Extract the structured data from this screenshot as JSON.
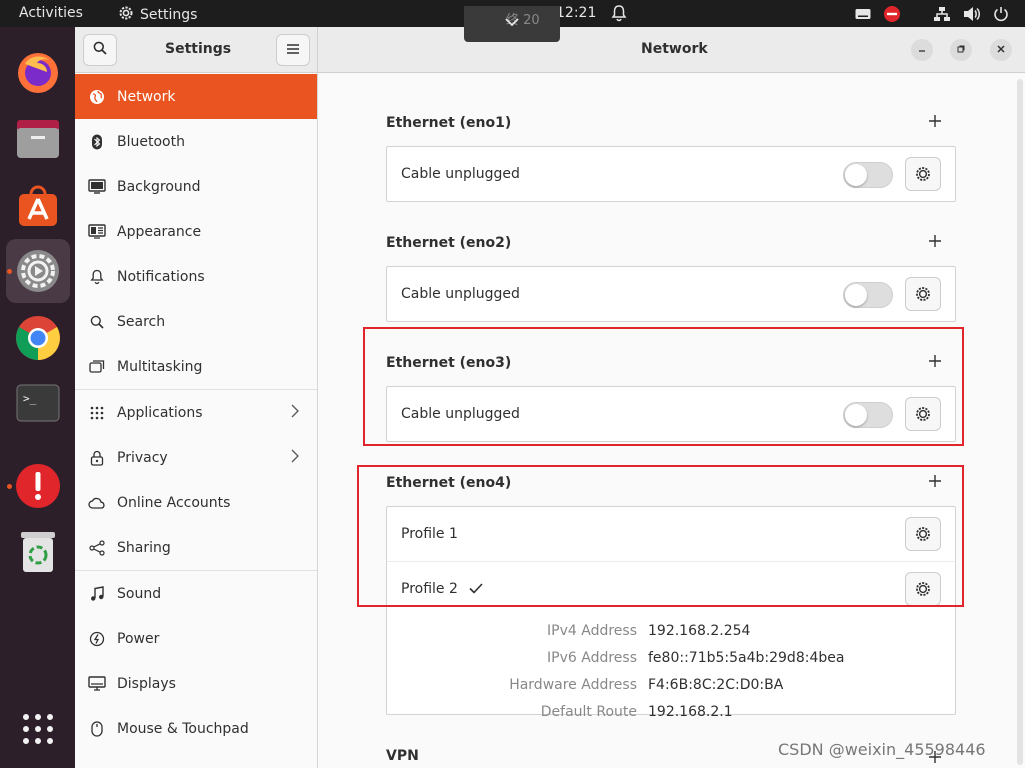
{
  "topbar": {
    "activities": "Activities",
    "app_name": "Settings",
    "clock": "12:21",
    "notif_dim_text": "终 20"
  },
  "dock": {
    "items": [
      "firefox-icon",
      "files-icon",
      "software-icon",
      "settings-icon",
      "chrome-icon",
      "terminal-icon",
      "updater-icon",
      "trash-icon",
      "apps-grid-icon"
    ]
  },
  "header": {
    "sidebar_title": "Settings",
    "page_title": "Network"
  },
  "sidebar": {
    "items": [
      {
        "label": "Network",
        "icon": "network-icon",
        "selected": true
      },
      {
        "label": "Bluetooth",
        "icon": "bluetooth-icon"
      },
      {
        "label": "Background",
        "icon": "background-icon"
      },
      {
        "label": "Appearance",
        "icon": "appearance-icon"
      },
      {
        "label": "Notifications",
        "icon": "bell-icon"
      },
      {
        "label": "Search",
        "icon": "search-icon"
      },
      {
        "label": "Multitasking",
        "icon": "multitasking-icon"
      },
      {
        "label": "Applications",
        "icon": "grid-icon",
        "chevron": true
      },
      {
        "label": "Privacy",
        "icon": "lock-icon",
        "chevron": true
      },
      {
        "label": "Online Accounts",
        "icon": "cloud-icon"
      },
      {
        "label": "Sharing",
        "icon": "share-icon"
      },
      {
        "label": "Sound",
        "icon": "music-icon"
      },
      {
        "label": "Power",
        "icon": "power-icon"
      },
      {
        "label": "Displays",
        "icon": "display-icon"
      },
      {
        "label": "Mouse & Touchpad",
        "icon": "mouse-icon"
      }
    ]
  },
  "network": {
    "sections": [
      {
        "title": "Ethernet (eno1)",
        "status": "Cable unplugged",
        "enabled": false
      },
      {
        "title": "Ethernet (eno2)",
        "status": "Cable unplugged",
        "enabled": false
      },
      {
        "title": "Ethernet (eno3)",
        "status": "Cable unplugged",
        "enabled": false
      }
    ],
    "eno4": {
      "title": "Ethernet (eno4)",
      "profile1": "Profile 1",
      "profile2": "Profile 2",
      "details": [
        {
          "key": "IPv4 Address",
          "value": "192.168.2.254"
        },
        {
          "key": "IPv6 Address",
          "value": "fe80::71b5:5a4b:29d8:4bea"
        },
        {
          "key": "Hardware Address",
          "value": "F4:6B:8C:2C:D0:BA"
        },
        {
          "key": "Default Route",
          "value": "192.168.2.1"
        }
      ]
    },
    "vpn_title": "VPN"
  },
  "watermark": "CSDN @weixin_45598446",
  "colors": {
    "accent": "#e95420",
    "highlight": "#e0262a"
  }
}
